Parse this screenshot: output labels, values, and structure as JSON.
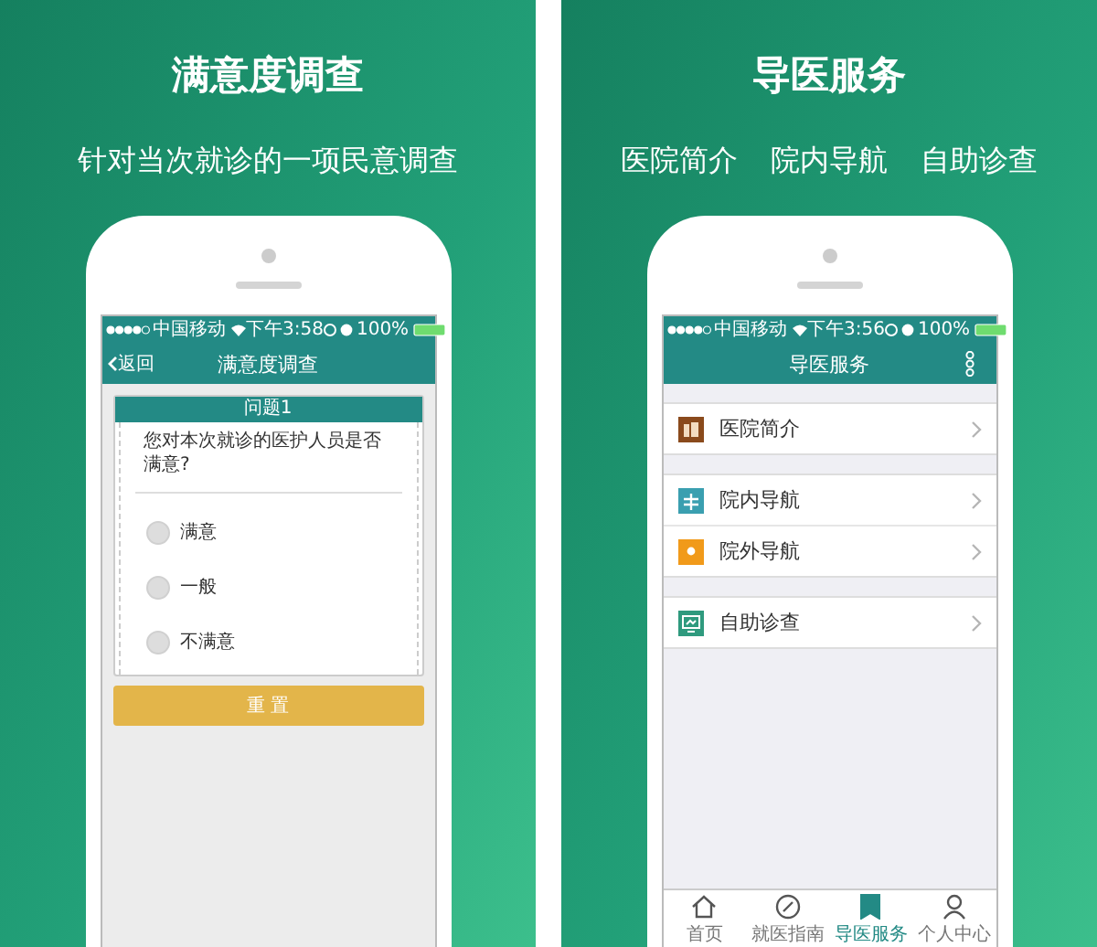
{
  "panels": [
    {
      "kind": "survey",
      "title": "满意度调查",
      "taglines": [
        "针对当次就诊的一项民意调查"
      ],
      "phone": {
        "status_bar": {
          "carrier": "中国移动",
          "time": "下午3:58",
          "battery": "100%"
        },
        "nav": {
          "back": "返回",
          "title": "满意度调查"
        },
        "question_header": "问题1",
        "question": "您对本次就诊的医护人员是否满意?",
        "options": [
          {
            "label": "满意",
            "selected": false
          },
          {
            "label": "一般",
            "selected": false
          },
          {
            "label": "不满意",
            "selected": false
          }
        ],
        "reset_button": "重 置"
      }
    },
    {
      "kind": "menu",
      "title": "导医服务",
      "taglines": [
        "医院简介",
        "院内导航",
        "自助诊查"
      ],
      "phone": {
        "status_bar": {
          "carrier": "中国移动",
          "time": "下午3:56",
          "battery": "100%"
        },
        "nav": {
          "title": "导医服务"
        },
        "groups": [
          [
            {
              "label": "医院简介",
              "kind": "building",
              "color": "#8a4a1c"
            }
          ],
          [
            {
              "label": "院内导航",
              "kind": "split",
              "color": "#3a9fb0"
            },
            {
              "label": "院外导航",
              "kind": "pin",
              "color": "#f19a1a"
            }
          ],
          [
            {
              "label": "自助诊查",
              "kind": "monitor",
              "color": "#2f9a7e"
            }
          ]
        ],
        "tabs": [
          {
            "label": "首页",
            "kind": "home",
            "selected": false
          },
          {
            "label": "就医指南",
            "kind": "compass",
            "selected": false
          },
          {
            "label": "导医服务",
            "kind": "bookmark",
            "selected": true
          },
          {
            "label": "个人中心",
            "kind": "person",
            "selected": false
          }
        ]
      }
    }
  ]
}
